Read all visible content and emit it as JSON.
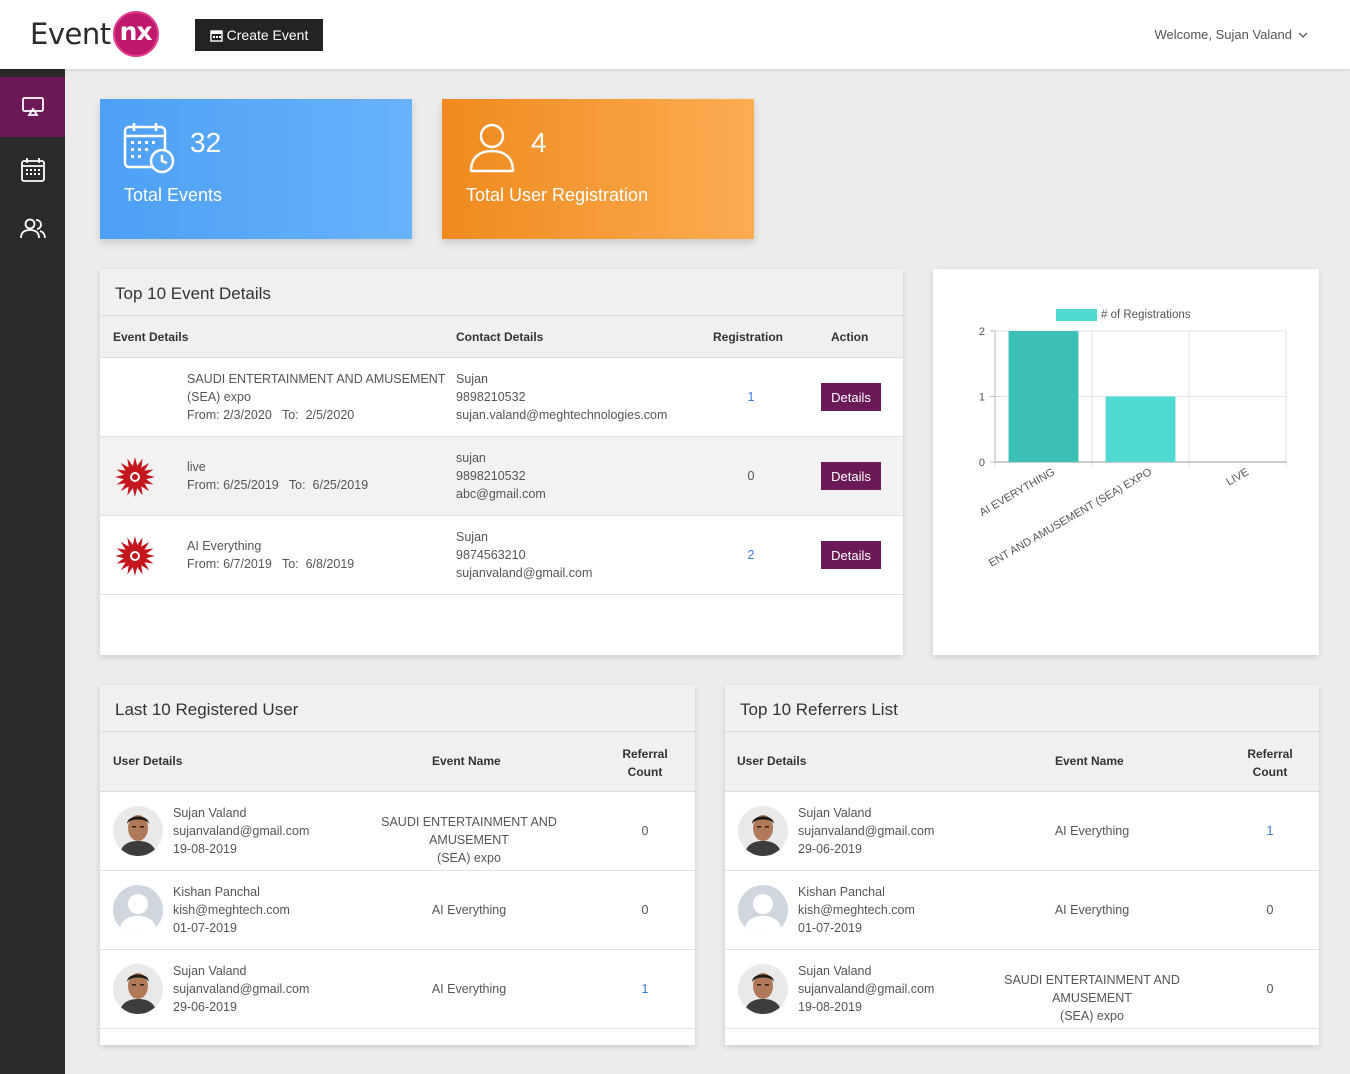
{
  "header": {
    "logo_text": "Event",
    "logo_badge": "nx",
    "create_label": "Create Event",
    "welcome": "Welcome, Sujan Valand"
  },
  "stats": [
    {
      "value": "32",
      "label": "Total Events"
    },
    {
      "value": "4",
      "label": "Total User Registration"
    }
  ],
  "top_events": {
    "title": "Top 10 Event Details",
    "headers": [
      "Event Details",
      "Contact Details",
      "Registration",
      "Action"
    ],
    "rows": [
      {
        "name": "SAUDI ENTERTAINMENT AND AMUSEMENT",
        "name2": "(SEA) expo",
        "dates": "From: 2/3/2020   To:  2/5/2020",
        "contact_name": "Sujan",
        "phone": "9898210532",
        "email": "sujan.valand@meghtechnologies.com",
        "registration": "1",
        "action": "Details"
      },
      {
        "name": "live",
        "name2": "",
        "dates": "From: 6/25/2019   To:  6/25/2019",
        "contact_name": "sujan",
        "phone": "9898210532",
        "email": "abc@gmail.com",
        "registration": "0",
        "action": "Details"
      },
      {
        "name": "AI Everything",
        "name2": "",
        "dates": "From: 6/7/2019   To:  6/8/2019",
        "contact_name": "Sujan",
        "phone": "9874563210",
        "email": "sujanvaland@gmail.com",
        "registration": "2",
        "action": "Details"
      }
    ]
  },
  "chart_data": {
    "type": "bar",
    "categories": [
      "AI EVERYTHING",
      "SAUDI ENTERTAINMENT AND AMUSEMENT (SEA) EXPO",
      "LIVE"
    ],
    "category_labels_visible": [
      "AI EVERYTHING",
      "ENT AND AMUSEMENT (SEA) EXPO",
      "LIVE"
    ],
    "series": [
      {
        "name": "# of Registrations",
        "values": [
          2,
          1,
          0
        ]
      }
    ],
    "ylim": [
      0,
      2
    ],
    "yticks": [
      "0",
      "1",
      "2"
    ],
    "colors": [
      "#3cbfb4",
      "#4fd9d2"
    ],
    "legend": "top",
    "grid": true
  },
  "last_users": {
    "title": "Last 10 Registered User",
    "headers": [
      "User Details",
      "Event Name",
      "Referral",
      "Count"
    ],
    "rows": [
      {
        "name": "Sujan Valand",
        "email": "sujanvaland@gmail.com",
        "date": "19-08-2019",
        "event": "SAUDI ENTERTAINMENT AND AMUSEMENT",
        "event2": "(SEA) expo",
        "count": "0",
        "photo": "person"
      },
      {
        "name": "Kishan Panchal",
        "email": "kish@meghtech.com",
        "date": "01-07-2019",
        "event": "AI Everything",
        "event2": "",
        "count": "0",
        "photo": "placeholder"
      },
      {
        "name": "Sujan Valand",
        "email": "sujanvaland@gmail.com",
        "date": "29-06-2019",
        "event": "AI Everything",
        "event2": "",
        "count": "1",
        "photo": "person"
      }
    ]
  },
  "referrers": {
    "title": "Top 10 Referrers List",
    "headers": [
      "User Details",
      "Event Name",
      "Referral",
      "Count"
    ],
    "rows": [
      {
        "name": "Sujan Valand",
        "email": "sujanvaland@gmail.com",
        "date": "29-06-2019",
        "event": "AI Everything",
        "event2": "",
        "count": "1",
        "photo": "person"
      },
      {
        "name": "Kishan Panchal",
        "email": "kish@meghtech.com",
        "date": "01-07-2019",
        "event": "AI Everything",
        "event2": "",
        "count": "0",
        "photo": "placeholder"
      },
      {
        "name": "Sujan Valand",
        "email": "sujanvaland@gmail.com",
        "date": "19-08-2019",
        "event": "SAUDI ENTERTAINMENT AND AMUSEMENT",
        "event2": "(SEA) expo",
        "count": "0",
        "photo": "person"
      }
    ]
  },
  "icons": {
    "sidebar": [
      "dashboard-icon",
      "calendar-icon",
      "users-icon"
    ],
    "stats": [
      "calendar-clock-icon",
      "user-icon"
    ]
  }
}
